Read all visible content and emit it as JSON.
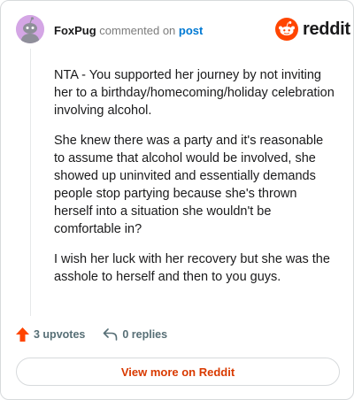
{
  "comment": {
    "author": "FoxPug",
    "action_text": "commented on",
    "post_link": "post",
    "paragraphs": [
      "NTA - You supported her journey by not inviting her to a birthday/homecoming/holiday celebration involving alcohol.",
      "She knew there was a party and it's reasonable to assume that alcohol would be involved, she showed up uninvited and essentially demands people stop partying because she's thrown herself into a situation she wouldn't be comfortable in?",
      "I wish her luck with her recovery but she was the asshole to herself and then to you guys."
    ]
  },
  "brand": {
    "logo_text": "reddit",
    "logo_icon": "reddit-snoo-icon",
    "accent_color": "#ff4500"
  },
  "footer": {
    "upvotes_label": "3 upvotes",
    "upvote_icon": "upvote-arrow-icon",
    "replies_label": "0 replies",
    "reply_icon": "reply-arrow-icon"
  },
  "cta": {
    "label": "View more on Reddit",
    "color": "#d93a00"
  },
  "avatar": {
    "icon": "snoo-avatar-icon",
    "background_color": "#d4a6e5"
  }
}
